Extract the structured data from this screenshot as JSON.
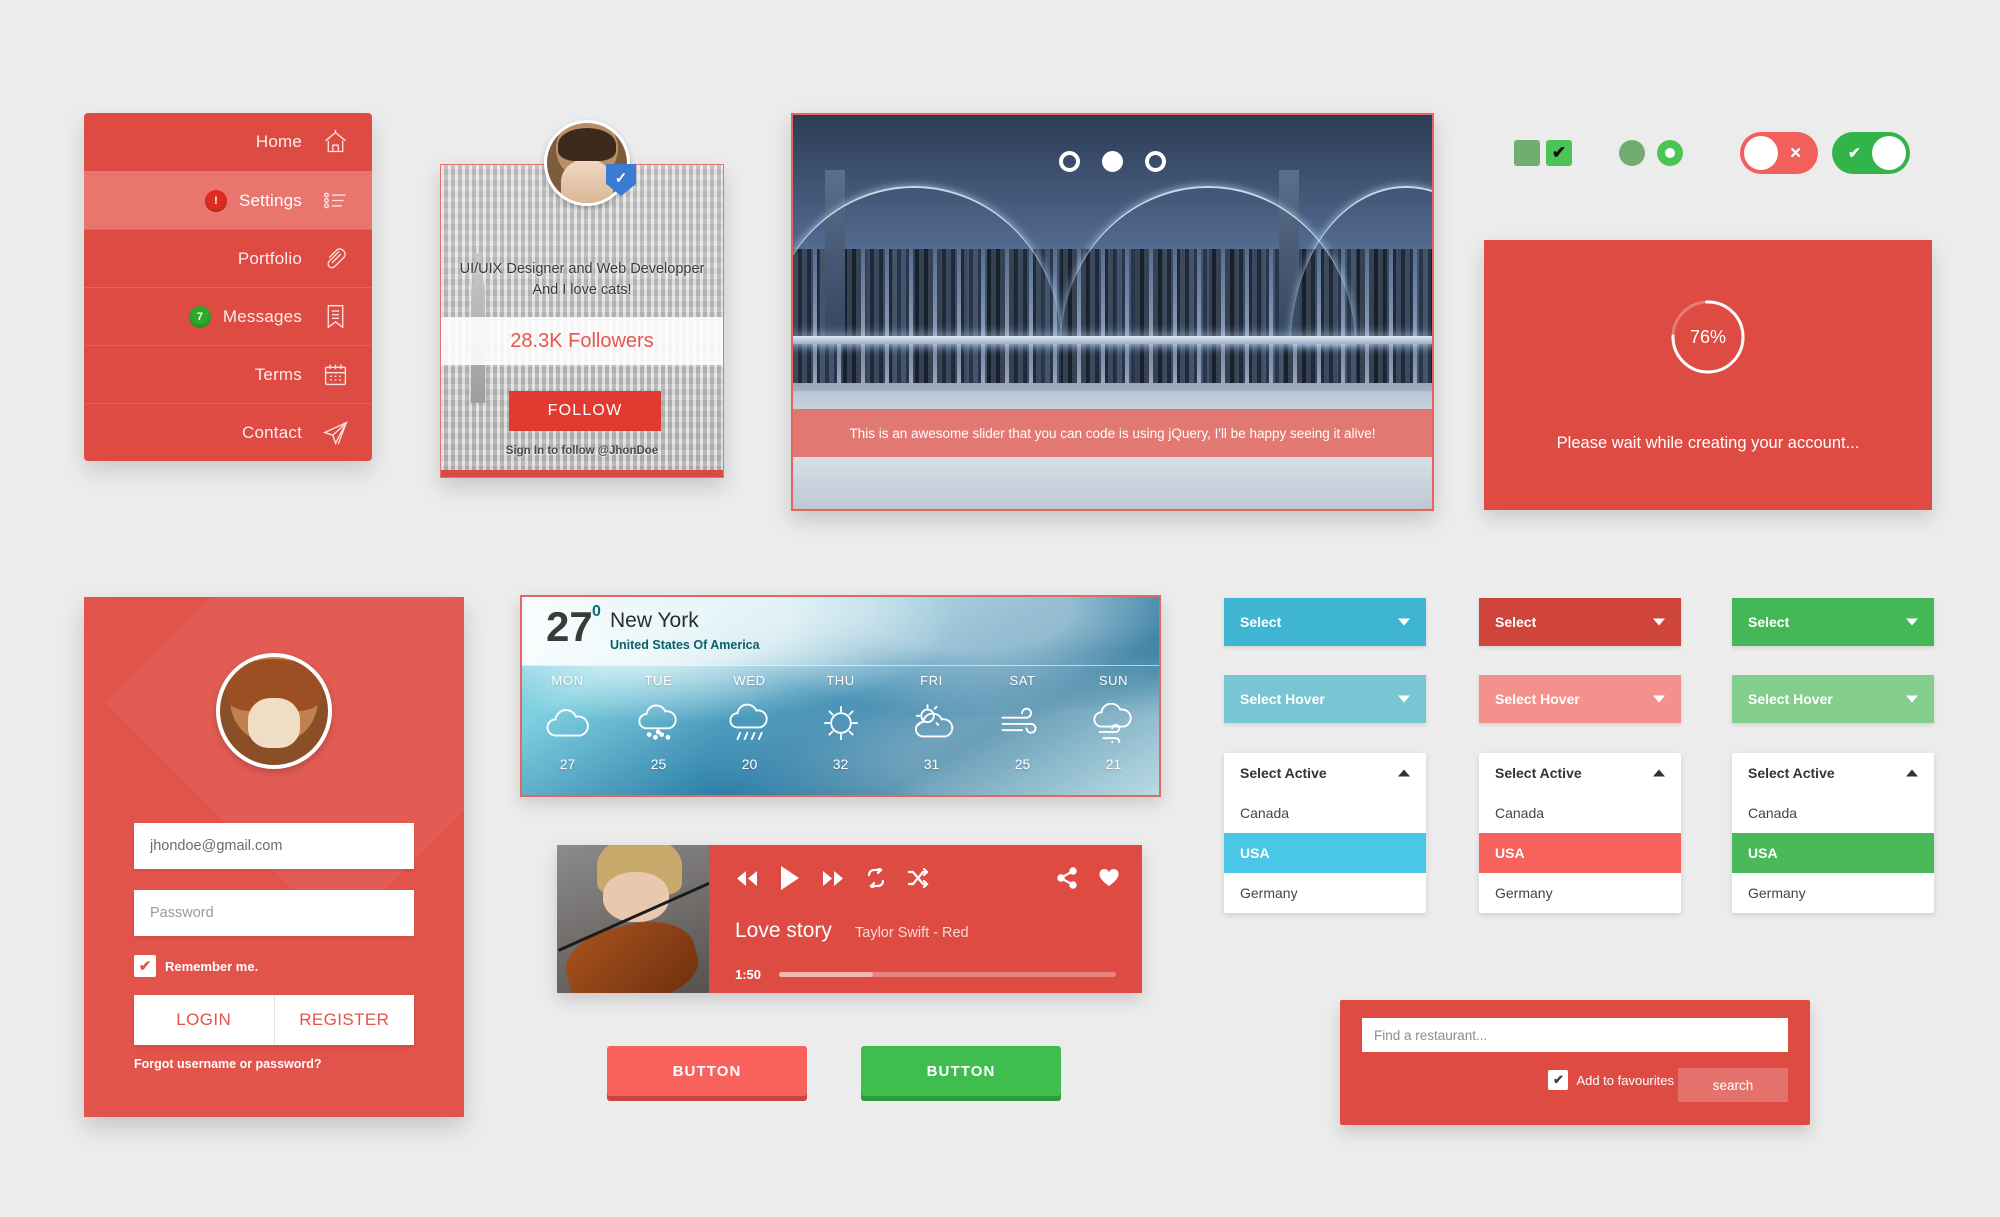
{
  "menu": {
    "items": [
      {
        "label": "Home",
        "icon": "home-icon",
        "badge": null,
        "badge_color": null,
        "active": false
      },
      {
        "label": "Settings",
        "icon": "list-icon",
        "badge": "!",
        "badge_color": "#e02b20",
        "active": true
      },
      {
        "label": "Portfolio",
        "icon": "paperclip-icon",
        "badge": null,
        "badge_color": null,
        "active": false
      },
      {
        "label": "Messages",
        "icon": "bookmark-icon",
        "badge": "7",
        "badge_color": "#2aa92a",
        "active": false
      },
      {
        "label": "Terms",
        "icon": "calendar-icon",
        "badge": null,
        "badge_color": null,
        "active": false
      },
      {
        "label": "Contact",
        "icon": "paper-plane-icon",
        "badge": null,
        "badge_color": null,
        "active": false
      }
    ]
  },
  "profile": {
    "bio_line1": "UI/UIX Designer and Web Developper",
    "bio_line2": "And I love cats!",
    "followers": "28.3K Followers",
    "follow_button": "FOLLOW",
    "signin_note": "Sign In to follow @JhonDoe",
    "verified_icon": "verified-check-icon",
    "accent": "#e23a30"
  },
  "slider": {
    "caption": "This is an awesome slider that you can code is using jQuery, I'll be happy seeing it alive!",
    "dots": [
      {
        "active": false
      },
      {
        "active": true
      },
      {
        "active": false
      }
    ],
    "caption_bg": "#e26a62"
  },
  "controls": {
    "checkbox_unchecked_label": "",
    "checkbox_checked_mark": "✔",
    "toggle_off_mark": "✕",
    "toggle_on_mark": "✔",
    "green": "#4cc455",
    "green_muted": "#71ac71",
    "red": "#f2605c",
    "toggle_on_bg": "#33b44a"
  },
  "loading": {
    "percent": "76%",
    "percent_value": 76,
    "message": "Please wait while creating your account...",
    "bg": "#dd4b43"
  },
  "login": {
    "email_value": "jhondoe@gmail.com",
    "email_placeholder": "jhondoe@gmail.com",
    "password_placeholder": "Password",
    "remember_label": "Remember me.",
    "remember_checked": true,
    "login_button": "LOGIN",
    "register_button": "REGISTER",
    "forgot_link": "Forgot username or password?",
    "bg": "#e2534b",
    "accent_text": "#e2534b"
  },
  "weather": {
    "temp": "27",
    "degree": "0",
    "city": "New York",
    "country": "United States Of America",
    "days": [
      {
        "name": "MON",
        "icon": "cloud-icon",
        "temp": "27"
      },
      {
        "name": "TUE",
        "icon": "snow-icon",
        "temp": "25"
      },
      {
        "name": "WED",
        "icon": "rain-icon",
        "temp": "20"
      },
      {
        "name": "THU",
        "icon": "sun-icon",
        "temp": "32"
      },
      {
        "name": "FRI",
        "icon": "partly-sunny-icon",
        "temp": "31"
      },
      {
        "name": "SAT",
        "icon": "wind-icon",
        "temp": "25"
      },
      {
        "name": "SUN",
        "icon": "cloud-wind-icon",
        "temp": "21"
      }
    ]
  },
  "player": {
    "track_title": "Love story",
    "track_artist": "Taylor Swift - Red",
    "current_time": "1:50",
    "progress_percent": 28,
    "controls": [
      "rewind-icon",
      "play-icon",
      "forward-icon",
      "repeat-icon",
      "shuffle-icon",
      "share-icon",
      "heart-icon"
    ],
    "bg": "#dd4b43"
  },
  "buttons": {
    "red_label": "BUTTON",
    "green_label": "BUTTON",
    "red_bg": "#f8615c",
    "green_bg": "#3fbd4f"
  },
  "selects": [
    {
      "theme": "blue",
      "base_bg": "#3fb6d1",
      "hover_bg": "#78c6d4",
      "active_bg": "#4ac6e6",
      "default_label": "Select",
      "hover_label": "Select Hover",
      "active_label": "Select Active",
      "options": [
        {
          "label": "Canada",
          "selected": false
        },
        {
          "label": "USA",
          "selected": true
        },
        {
          "label": "Germany",
          "selected": false
        }
      ]
    },
    {
      "theme": "red",
      "base_bg": "#cf453c",
      "hover_bg": "#f4918c",
      "active_bg": "#f8625d",
      "default_label": "Select",
      "hover_label": "Select Hover",
      "active_label": "Select Active",
      "options": [
        {
          "label": "Canada",
          "selected": false
        },
        {
          "label": "USA",
          "selected": true
        },
        {
          "label": "Germany",
          "selected": false
        }
      ]
    },
    {
      "theme": "green",
      "base_bg": "#44b856",
      "hover_bg": "#83ce8d",
      "active_bg": "#49b95a",
      "default_label": "Select",
      "hover_label": "Select Hover",
      "active_label": "Select Active",
      "options": [
        {
          "label": "Canada",
          "selected": false
        },
        {
          "label": "USA",
          "selected": true
        },
        {
          "label": "Germany",
          "selected": false
        }
      ]
    }
  ],
  "search_panel": {
    "input_placeholder": "Find a restaurant...",
    "favourite_label": "Add to favourites",
    "favourite_checked": true,
    "search_button": "search",
    "bg": "#dd4b43"
  }
}
